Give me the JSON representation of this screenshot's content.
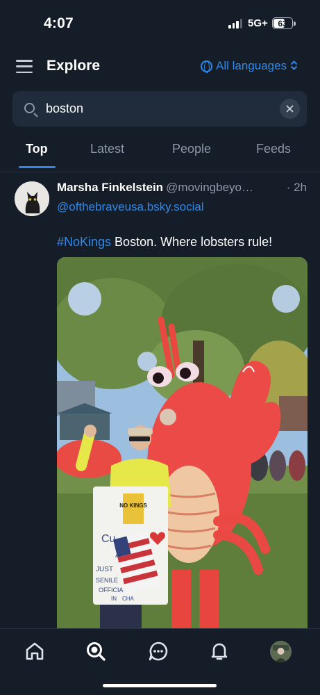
{
  "status_bar": {
    "time": "4:07",
    "network": "5G+",
    "battery": "63",
    "battery_level": 0.63
  },
  "header": {
    "menu_icon": "hamburger-menu-icon",
    "title": "Explore",
    "language_icon": "globe-icon",
    "language_label": "All languages",
    "language_chevron_icon": "chevron-up-down-icon"
  },
  "search": {
    "icon": "search-icon",
    "value": "boston",
    "clear_icon": "close-icon"
  },
  "tabs": {
    "items": [
      {
        "label": "Top",
        "active": true
      },
      {
        "label": "Latest",
        "active": false
      },
      {
        "label": "People",
        "active": false
      },
      {
        "label": "Feeds",
        "active": false
      }
    ],
    "accent_color": "#2f88ea"
  },
  "post": {
    "author_name": "Marsha Finkelstein",
    "author_handle": "@movingbeyo…",
    "time": "· 2h",
    "mention": "@ofthebraveusa.bsky.social",
    "hashtag": "#NoKings",
    "text": " Boston. Where lobsters rule!",
    "avatar_icon": "black-cat-avatar",
    "image": {
      "subject": "inflatable-lobster-costume-protest-photo",
      "sign_top": "NO KINGS",
      "sign_lines": [
        "Cu",
        "A",
        "JUST",
        "SENILE",
        "OFFICIA",
        "IN",
        "CHA"
      ]
    }
  },
  "bottom_nav": {
    "items": [
      {
        "icon": "home-icon",
        "active": false
      },
      {
        "icon": "search-icon",
        "active": true
      },
      {
        "icon": "chat-icon",
        "active": false
      },
      {
        "icon": "bell-icon",
        "active": false
      },
      {
        "icon": "profile-avatar",
        "active": false
      }
    ]
  },
  "colors": {
    "background": "#151d28",
    "surface": "#202c3b",
    "accent": "#2f88ea",
    "muted_text": "#8c98a8"
  }
}
